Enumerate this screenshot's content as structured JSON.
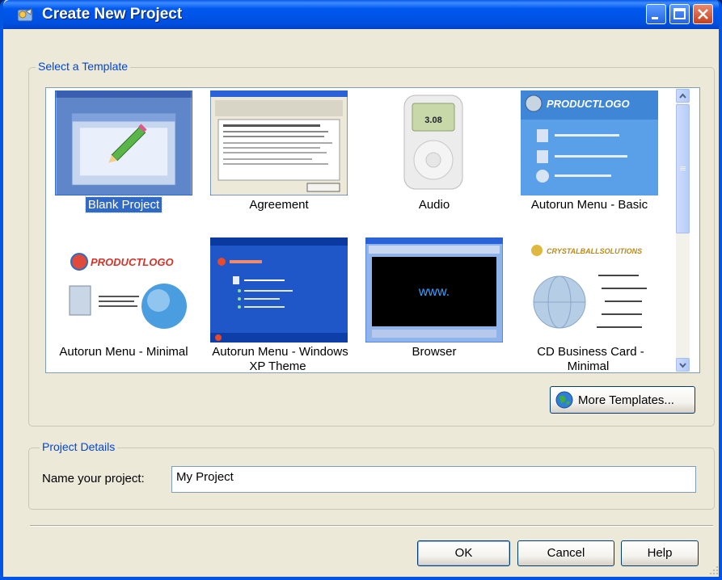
{
  "window": {
    "title": "Create New Project"
  },
  "template_group": {
    "legend": "Select a Template"
  },
  "templates": [
    {
      "label": "Blank Project",
      "selected": true,
      "icon": "blank-window-pencil"
    },
    {
      "label": "Agreement",
      "selected": false,
      "icon": "agreement-dialog"
    },
    {
      "label": "Audio",
      "selected": false,
      "icon": "media-player"
    },
    {
      "label": "Autorun Menu - Basic",
      "selected": false,
      "icon": "productlogo-blue-menu"
    },
    {
      "label": "Autorun Menu - Minimal",
      "selected": false,
      "icon": "productlogo-globe"
    },
    {
      "label": "Autorun Menu - Windows XP Theme",
      "selected": false,
      "icon": "xp-menu"
    },
    {
      "label": "Browser",
      "selected": false,
      "icon": "browser-window"
    },
    {
      "label": "CD Business Card - Minimal",
      "selected": false,
      "icon": "crystalball-globe"
    }
  ],
  "thumb_text": {
    "productlogo": "PRODUCTLOGO",
    "audio_readout": "3.08",
    "browser_www": "www.",
    "crystalball": "CRYSTALBALLSOLUTIONS"
  },
  "more_templates": {
    "label": "More Templates..."
  },
  "details_group": {
    "legend": "Project Details"
  },
  "project_name": {
    "label": "Name your project:",
    "value": "My Project"
  },
  "buttons": {
    "ok": "OK",
    "cancel": "Cancel",
    "help": "Help"
  },
  "colors": {
    "title_bar": "#0054e3",
    "dialog_bg": "#ece9d8",
    "selection": "#316ac5",
    "group_legend": "#0046d5"
  }
}
